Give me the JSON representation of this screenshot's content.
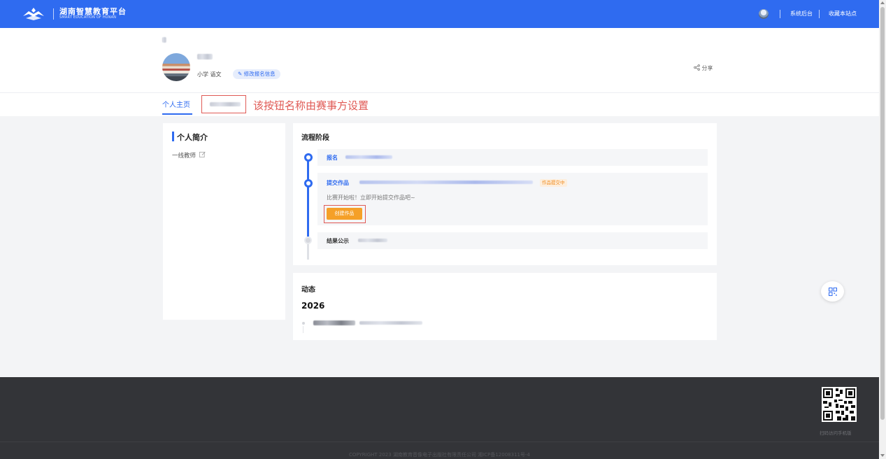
{
  "header": {
    "site_title": "湖南智慧教育平台",
    "site_subtitle": "SMART EDUCATION OF HUNAN",
    "links": [
      "系统后台",
      "收藏本站点"
    ],
    "brand_color": "#2f6bf0"
  },
  "profile": {
    "meta": "小学 语文",
    "edit_label": "修改报名信息",
    "share_label": "分享"
  },
  "tabs": {
    "home": "个人主页",
    "annotation": "该按钮名称由赛事方设置"
  },
  "intro": {
    "title": "个人简介",
    "text": "一线教师"
  },
  "process": {
    "title": "流程阶段",
    "steps": [
      {
        "label": "报名",
        "status": "done"
      },
      {
        "label": "提交作品",
        "badge": "作品提交中",
        "desc": "比赛开始啦！立即开始提交作品吧~",
        "button": "创建作品",
        "status": "active"
      },
      {
        "label": "结果公示",
        "status": "pending"
      }
    ]
  },
  "dynamics": {
    "title": "动态",
    "year": "2026"
  },
  "footer": {
    "qr_caption": "扫码访问手机版",
    "copyright": "COPYRIGHT 2023 湖南教育音像电子出版社有限责任公司 湘ICP备12008311号-4"
  }
}
